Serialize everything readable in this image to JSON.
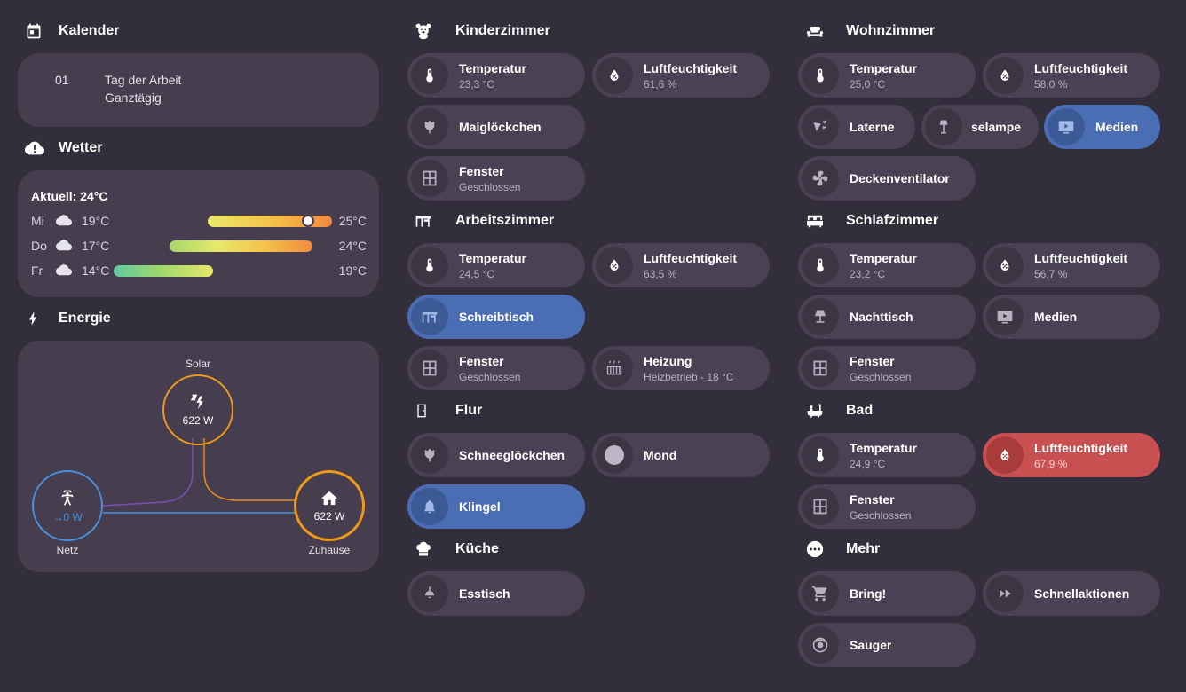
{
  "calendar": {
    "title": "Kalender",
    "event": {
      "day": "01",
      "name": "Tag der Arbeit",
      "when": "Ganztägig"
    }
  },
  "weather": {
    "title": "Wetter",
    "current": "Aktuell: 24°C",
    "days": [
      {
        "day": "Mi",
        "low": "19°C",
        "high": "25°C"
      },
      {
        "day": "Do",
        "low": "17°C",
        "high": "24°C"
      },
      {
        "day": "Fr",
        "low": "14°C",
        "high": "19°C"
      }
    ]
  },
  "energy": {
    "title": "Energie",
    "solar_label": "Solar",
    "solar_value": "622 W",
    "grid_label": "Netz",
    "grid_value": "→0 W",
    "home_label": "Zuhause",
    "home_value": "622 W"
  },
  "kinderzimmer": {
    "title": "Kinderzimmer",
    "temp_name": "Temperatur",
    "temp_value": "23,3 °C",
    "hum_name": "Luftfeuchtigkeit",
    "hum_value": "61,6 %",
    "light_name": "Maiglöckchen",
    "window_name": "Fenster",
    "window_state": "Geschlossen"
  },
  "arbeitszimmer": {
    "title": "Arbeitszimmer",
    "temp_name": "Temperatur",
    "temp_value": "24,5 °C",
    "hum_name": "Luftfeuchtigkeit",
    "hum_value": "63,5 %",
    "desk_name": "Schreibtisch",
    "window_name": "Fenster",
    "window_state": "Geschlossen",
    "heat_name": "Heizung",
    "heat_state": "Heizbetrieb - 18 °C"
  },
  "flur": {
    "title": "Flur",
    "light_name": "Schneeglöckchen",
    "moon_name": "Mond",
    "bell_name": "Klingel"
  },
  "kueche": {
    "title": "Küche",
    "light_name": "Esstisch"
  },
  "wohnzimmer": {
    "title": "Wohnzimmer",
    "temp_name": "Temperatur",
    "temp_value": "25,0 °C",
    "hum_name": "Luftfeuchtigkeit",
    "hum_value": "58,0 %",
    "lantern_name": "Laterne",
    "lamp_name": "selampe",
    "media_name": "Medien",
    "fan_name": "Deckenventilator"
  },
  "schlafzimmer": {
    "title": "Schlafzimmer",
    "temp_name": "Temperatur",
    "temp_value": "23,2 °C",
    "hum_name": "Luftfeuchtigkeit",
    "hum_value": "56,7 %",
    "night_name": "Nachttisch",
    "media_name": "Medien",
    "window_name": "Fenster",
    "window_state": "Geschlossen"
  },
  "bad": {
    "title": "Bad",
    "temp_name": "Temperatur",
    "temp_value": "24,9 °C",
    "hum_name": "Luftfeuchtigkeit",
    "hum_value": "67,9 %",
    "window_name": "Fenster",
    "window_state": "Geschlossen"
  },
  "mehr": {
    "title": "Mehr",
    "bring_name": "Bring!",
    "quick_name": "Schnellaktionen",
    "vacuum_name": "Sauger"
  },
  "colors": {
    "background": "#322e3b",
    "card": "#463e4f",
    "tile": "#4a4254",
    "active_blue": "#4a6db3",
    "alert_red": "#c95050",
    "solar_orange": "#f09a1a",
    "grid_blue": "#4a8fd9"
  }
}
